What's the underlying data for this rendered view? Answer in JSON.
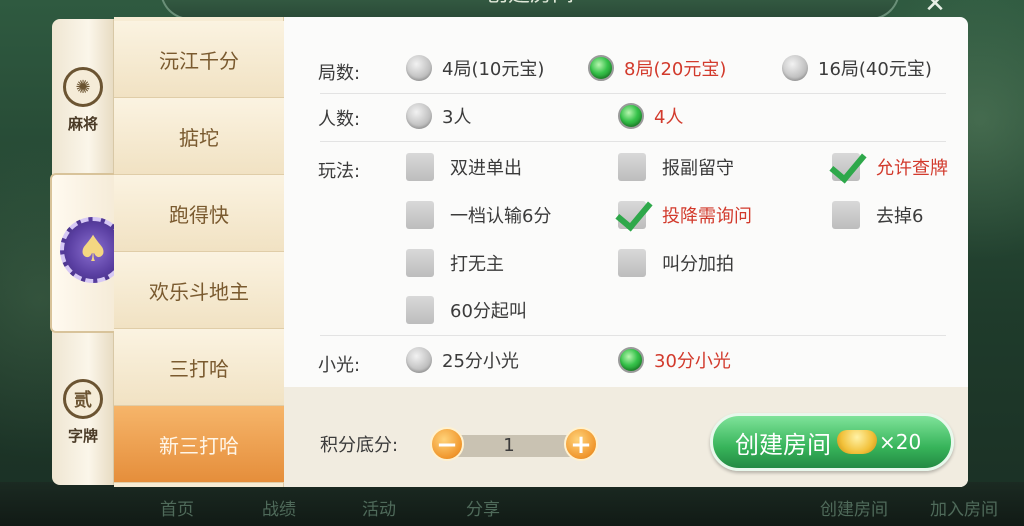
{
  "background": {
    "dialog_title": "创建房间",
    "bottom_bar": [
      "首页",
      "战绩",
      "活动",
      "分享",
      "创建房间",
      "加入房间"
    ]
  },
  "rail": {
    "items": [
      {
        "label": "麻将",
        "icon": "mahjong-coin-icon"
      },
      {
        "label": "",
        "icon": "poker-spade-chip-icon"
      },
      {
        "label": "字牌",
        "icon": "zipai-coin-icon",
        "glyph": "贰"
      }
    ]
  },
  "tabs": [
    {
      "label": "沅江千分",
      "active": false
    },
    {
      "label": "掂坨",
      "active": false
    },
    {
      "label": "跑得快",
      "active": false
    },
    {
      "label": "欢乐斗地主",
      "active": false
    },
    {
      "label": "三打哈",
      "active": false
    },
    {
      "label": "新三打哈",
      "active": true
    }
  ],
  "settings": {
    "rounds": {
      "label": "局数:",
      "options": [
        {
          "text": "4局(10元宝)",
          "selected": false
        },
        {
          "text": "8局(20元宝)",
          "selected": true
        },
        {
          "text": "16局(40元宝)",
          "selected": false
        }
      ]
    },
    "players": {
      "label": "人数:",
      "options": [
        {
          "text": "3人",
          "selected": false
        },
        {
          "text": "4人",
          "selected": true
        }
      ]
    },
    "play": {
      "label": "玩法:",
      "options": [
        {
          "text": "双进单出",
          "checked": false
        },
        {
          "text": "报副留守",
          "checked": false
        },
        {
          "text": "允许查牌",
          "checked": true
        },
        {
          "text": "一档认输6分",
          "checked": false
        },
        {
          "text": "投降需询问",
          "checked": true
        },
        {
          "text": "去掉6",
          "checked": false
        },
        {
          "text": "打无主",
          "checked": false
        },
        {
          "text": "叫分加拍",
          "checked": false
        },
        {
          "text": "60分起叫",
          "checked": false
        }
      ]
    },
    "small_light": {
      "label": "小光:",
      "options": [
        {
          "text": "25分小光",
          "selected": false
        },
        {
          "text": "30分小光",
          "selected": true
        }
      ]
    }
  },
  "footer": {
    "base_score_label": "积分底分:",
    "base_score_value": "1",
    "create_label": "创建房间",
    "create_cost": "×20"
  },
  "colors": {
    "accent_selected": "#d23a2c",
    "tab_active": "#e58e3b",
    "create_button": "#37b45a"
  }
}
